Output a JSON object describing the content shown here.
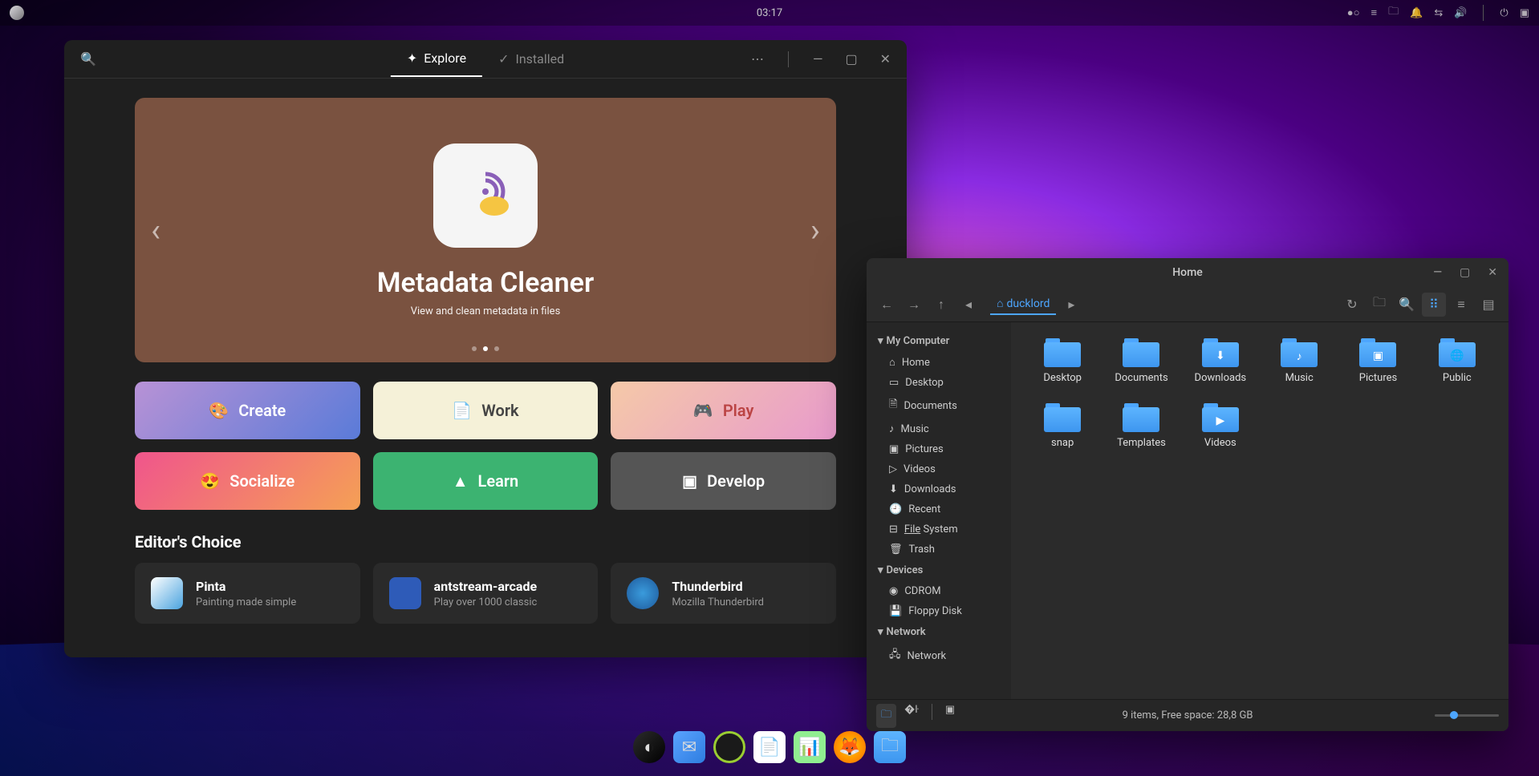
{
  "panel": {
    "clock": "03:17"
  },
  "appstore": {
    "tabs": {
      "explore": "Explore",
      "installed": "Installed"
    },
    "hero": {
      "title": "Metadata Cleaner",
      "subtitle": "View and clean metadata in files"
    },
    "categories": {
      "create": "Create",
      "work": "Work",
      "play": "Play",
      "socialize": "Socialize",
      "learn": "Learn",
      "develop": "Develop"
    },
    "editors_choice_title": "Editor's Choice",
    "apps": [
      {
        "name": "Pinta",
        "desc": "Painting made simple"
      },
      {
        "name": "antstream-arcade",
        "desc": "Play over 1000 classic"
      },
      {
        "name": "Thunderbird",
        "desc": "Mozilla Thunderbird"
      }
    ]
  },
  "filemanager": {
    "title": "Home",
    "breadcrumb": "ducklord",
    "sidebar": {
      "my_computer": "My Computer",
      "home": "Home",
      "desktop": "Desktop",
      "documents": "Documents",
      "music": "Music",
      "pictures": "Pictures",
      "videos": "Videos",
      "downloads": "Downloads",
      "recent": "Recent",
      "filesystem_a": "File",
      "filesystem_b": "System",
      "trash": "Trash",
      "devices": "Devices",
      "cdrom": "CDROM",
      "floppy": "Floppy Disk",
      "network": "Network",
      "network_item": "Network"
    },
    "folders": [
      {
        "label": "Desktop",
        "badge": ""
      },
      {
        "label": "Documents",
        "badge": ""
      },
      {
        "label": "Downloads",
        "badge": "⬇"
      },
      {
        "label": "Music",
        "badge": "♪"
      },
      {
        "label": "Pictures",
        "badge": "▣"
      },
      {
        "label": "Public",
        "badge": "🌐"
      },
      {
        "label": "snap",
        "badge": ""
      },
      {
        "label": "Templates",
        "badge": ""
      },
      {
        "label": "Videos",
        "badge": "▶"
      }
    ],
    "status": "9 items, Free space: 28,8 GB"
  }
}
